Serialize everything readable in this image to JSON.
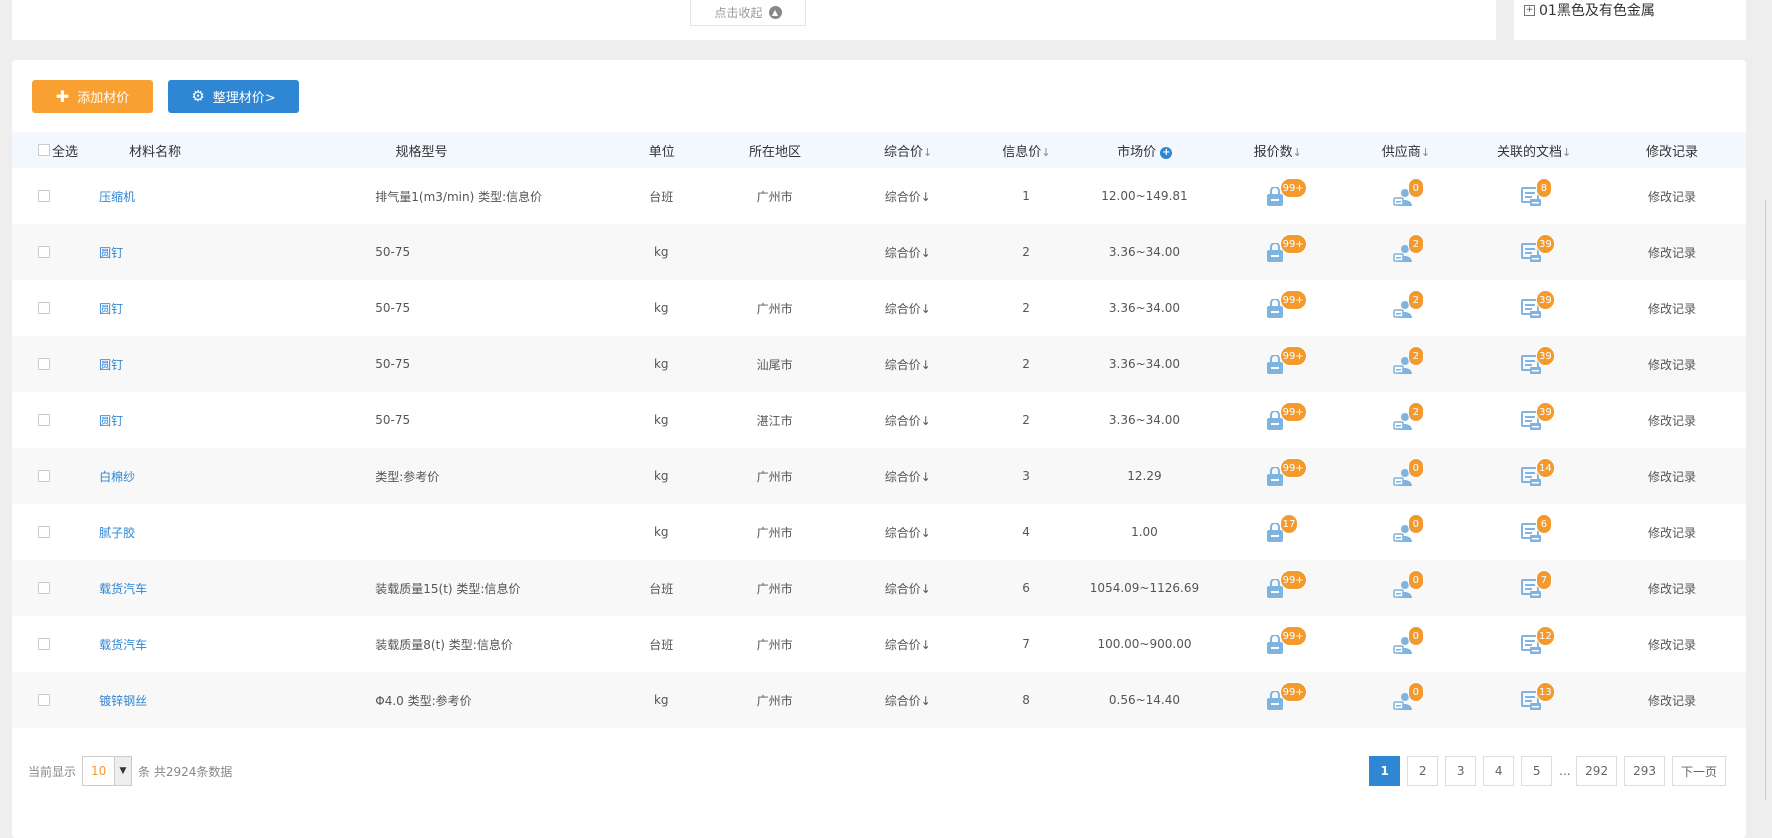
{
  "top": {
    "collapse_label": "点击收起",
    "tree_node_label": "01黑色及有色金属"
  },
  "toolbar": {
    "add_label": "添加材价",
    "organize_label": "整理材价>"
  },
  "table": {
    "headers": {
      "select_all": "全选",
      "name": "材料名称",
      "spec": "规格型号",
      "unit": "单位",
      "region": "所在地区",
      "composite_price": "综合价",
      "info_price": "信息价",
      "market_price": "市场价",
      "quote_count": "报价数",
      "supplier": "供应商",
      "docs": "关联的文档",
      "log": "修改记录"
    },
    "sort_arrow": "↓",
    "market_plus": "+",
    "rows": [
      {
        "name": "压缩机",
        "spec": "排气量1(m3/min) 类型:信息价",
        "unit": "台班",
        "region": "广州市",
        "composite": "综合价↓",
        "info": "1",
        "market": "12.00~149.81",
        "quotes": "99+",
        "suppliers": "0",
        "docs": "8",
        "log": "修改记录"
      },
      {
        "name": "圆钉",
        "spec": "50-75",
        "unit": "kg",
        "region": "",
        "composite": "综合价↓",
        "info": "2",
        "market": "3.36~34.00",
        "quotes": "99+",
        "suppliers": "2",
        "docs": "39",
        "log": "修改记录"
      },
      {
        "name": "圆钉",
        "spec": "50-75",
        "unit": "kg",
        "region": "广州市",
        "composite": "综合价↓",
        "info": "2",
        "market": "3.36~34.00",
        "quotes": "99+",
        "suppliers": "2",
        "docs": "39",
        "log": "修改记录"
      },
      {
        "name": "圆钉",
        "spec": "50-75",
        "unit": "kg",
        "region": "汕尾市",
        "composite": "综合价↓",
        "info": "2",
        "market": "3.36~34.00",
        "quotes": "99+",
        "suppliers": "2",
        "docs": "39",
        "log": "修改记录"
      },
      {
        "name": "圆钉",
        "spec": "50-75",
        "unit": "kg",
        "region": "湛江市",
        "composite": "综合价↓",
        "info": "2",
        "market": "3.36~34.00",
        "quotes": "99+",
        "suppliers": "2",
        "docs": "39",
        "log": "修改记录"
      },
      {
        "name": "白棉纱",
        "spec": "类型:参考价",
        "unit": "kg",
        "region": "广州市",
        "composite": "综合价↓",
        "info": "3",
        "market": "12.29",
        "quotes": "99+",
        "suppliers": "0",
        "docs": "14",
        "log": "修改记录"
      },
      {
        "name": "腻子胶",
        "spec": "",
        "unit": "kg",
        "region": "广州市",
        "composite": "综合价↓",
        "info": "4",
        "market": "1.00",
        "quotes": "17",
        "suppliers": "0",
        "docs": "6",
        "log": "修改记录"
      },
      {
        "name": "载货汽车",
        "spec": "装载质量15(t) 类型:信息价",
        "unit": "台班",
        "region": "广州市",
        "composite": "综合价↓",
        "info": "6",
        "market": "1054.09~1126.69",
        "quotes": "99+",
        "suppliers": "0",
        "docs": "7",
        "log": "修改记录"
      },
      {
        "name": "载货汽车",
        "spec": "装载质量8(t) 类型:信息价",
        "unit": "台班",
        "region": "广州市",
        "composite": "综合价↓",
        "info": "7",
        "market": "100.00~900.00",
        "quotes": "99+",
        "suppliers": "0",
        "docs": "12",
        "log": "修改记录"
      },
      {
        "name": "镀锌钢丝",
        "spec": "Φ4.0 类型:参考价",
        "unit": "kg",
        "region": "广州市",
        "composite": "综合价↓",
        "info": "8",
        "market": "0.56~14.40",
        "quotes": "99+",
        "suppliers": "0",
        "docs": "13",
        "log": "修改记录"
      }
    ]
  },
  "footer": {
    "showing_label": "当前显示",
    "page_size": "10",
    "total_label": "条 共2924条数据",
    "pages": [
      "1",
      "2",
      "3",
      "4",
      "5",
      "...",
      "292",
      "293"
    ],
    "next_label": "下一页"
  },
  "colors": {
    "accent_orange": "#f9a033",
    "accent_blue": "#2f86d2",
    "badge_orange": "#f39a2e",
    "icon_blue": "#7fb3e0"
  },
  "icons": {
    "quote_icon": "bag-icon",
    "supplier_icon": "supplier-icon",
    "docs_icon": "document-icon"
  }
}
